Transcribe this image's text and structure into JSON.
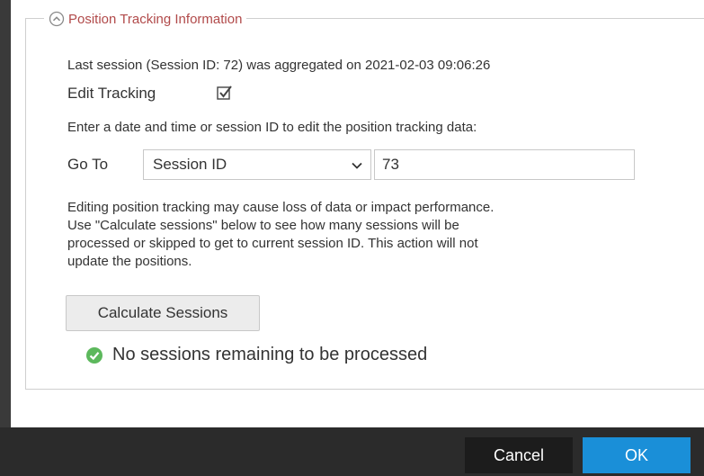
{
  "section": {
    "title": "Position Tracking Information",
    "title_color": "#b14a4a"
  },
  "last_session_text": "Last session (Session ID: 72) was aggregated on 2021-02-03 09:06:26",
  "edit_tracking": {
    "label": "Edit Tracking",
    "checked": true
  },
  "instructions": "Enter a date and time or session ID to edit the position tracking data:",
  "goto": {
    "label": "Go To",
    "select_value": "Session ID",
    "input_value": "73"
  },
  "warning_lines": [
    "Editing position tracking may cause loss of data or impact performance.",
    "Use \"Calculate sessions\" below to see how many sessions will be",
    "processed or skipped to get to current session ID. This action will not",
    "update the positions."
  ],
  "calculate_button": "Calculate Sessions",
  "status": {
    "text": "No sessions remaining to be processed",
    "icon": "check-circle-icon",
    "color": "#5cb85c"
  },
  "footer": {
    "cancel_label": "Cancel",
    "ok_label": "OK",
    "ok_color": "#1a8fd8"
  }
}
